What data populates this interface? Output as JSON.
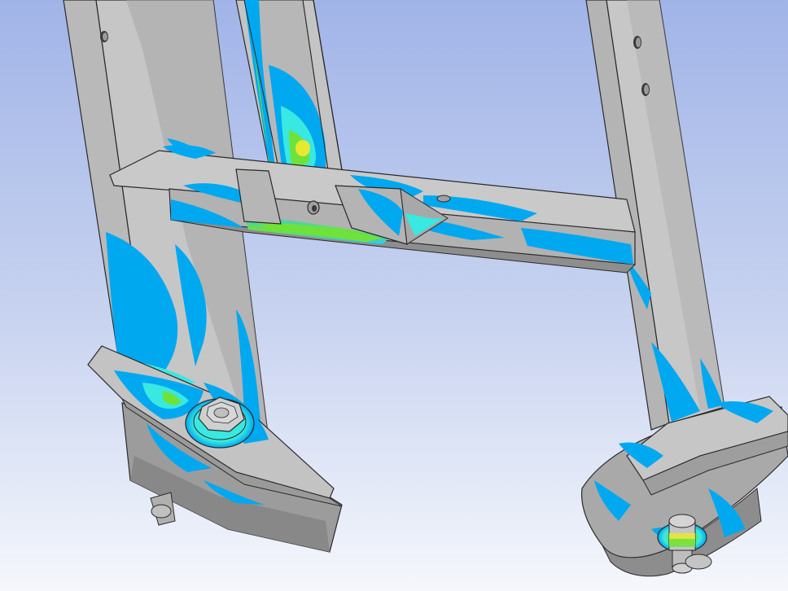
{
  "scene": {
    "description_visible_text": "",
    "colors": {
      "background_top": "#a4b6e8",
      "background_bottom": "#f4f6fb",
      "metal_light": "#c9c9c9",
      "metal_mid": "#b0b0b0",
      "metal_dark": "#8f8f8f",
      "edge": "#2a2a2a",
      "stress_low": "#00a8f0",
      "stress_low2": "#2fc8f5",
      "stress_cyan": "#39e8e0",
      "stress_mid": "#35e07a",
      "stress_green": "#6fe23a",
      "stress_high": "#e8e830",
      "stress_peak": "#f0a020"
    }
  }
}
